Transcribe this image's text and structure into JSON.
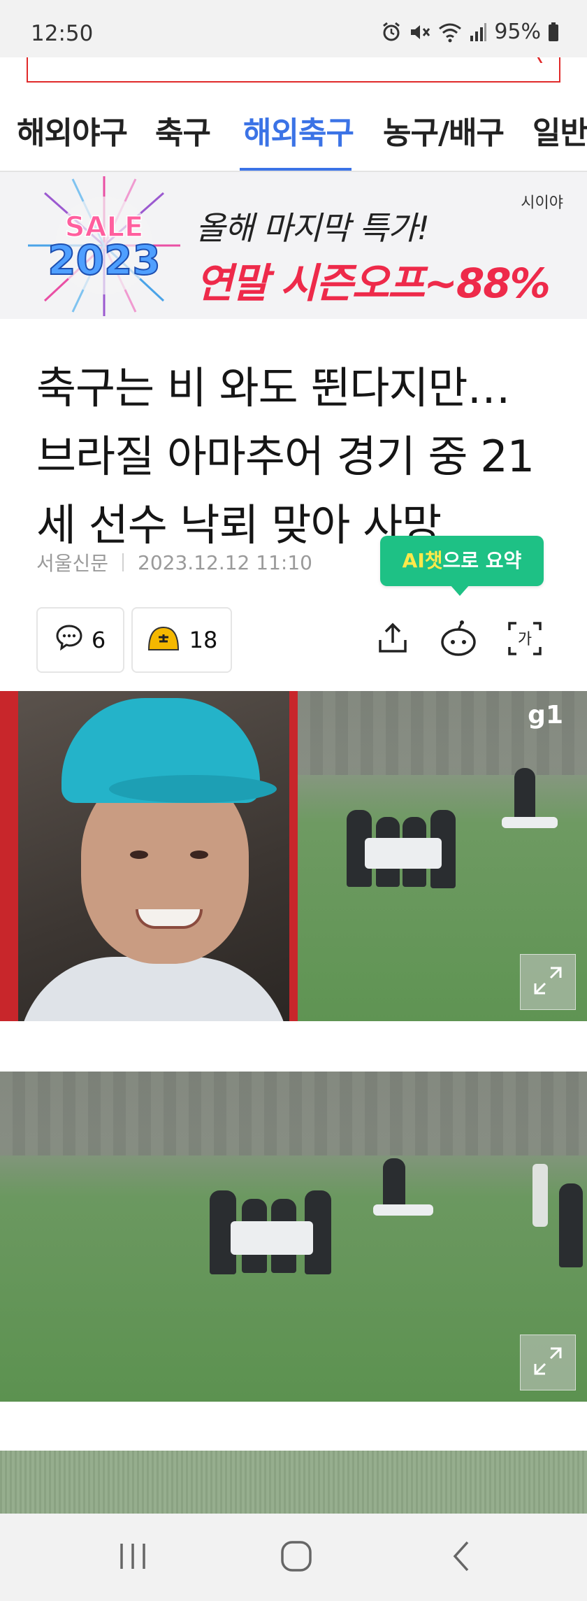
{
  "status_bar": {
    "time": "12:50",
    "battery": "95%",
    "icons": [
      "alarm-icon",
      "mute-icon",
      "wifi-icon",
      "signal-icon",
      "battery-icon"
    ]
  },
  "tabs": {
    "items": [
      {
        "label": "해외야구",
        "active": false
      },
      {
        "label": "축구",
        "active": false
      },
      {
        "label": "해외축구",
        "active": true
      },
      {
        "label": "농구/배구",
        "active": false
      },
      {
        "label": "일반",
        "active": false
      }
    ]
  },
  "ad": {
    "line1": "올해 마지막 특가!",
    "line2": "연말 시즌오프~88%",
    "brand": "시이야",
    "sale_badge": "SALE",
    "year_badge": "2023"
  },
  "article": {
    "headline_line1": "축구는 비 와도 뛴다지만…",
    "headline_line2": "브라질 아마추어 경기 중 21",
    "headline_line3": "세 선수 낙뢰 맞아 사망",
    "publisher": "서울신문",
    "datetime": "2023.12.12 11:10"
  },
  "ai_summary": {
    "label_highlight": "AI챗",
    "label_rest": "으로 요약"
  },
  "actions": {
    "comment_count": "6",
    "reaction_count": "18"
  },
  "photos": {
    "watermark": "g1"
  },
  "colors": {
    "accent_blue": "#3b73e6",
    "ad_red": "#ee2a4a",
    "ai_green": "#1ec185",
    "search_border": "#e02a2a"
  }
}
